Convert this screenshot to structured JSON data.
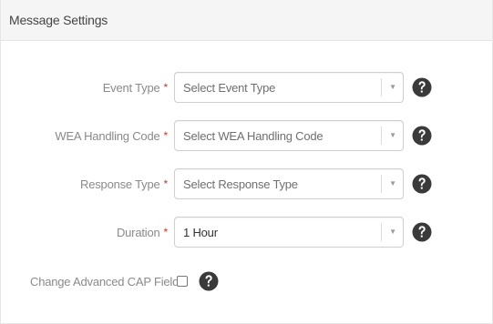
{
  "panel": {
    "title": "Message Settings"
  },
  "form": {
    "required_marker": "*",
    "fields": [
      {
        "label": "Event Type",
        "value": "Select Event Type",
        "is_placeholder": true
      },
      {
        "label": "WEA Handling Code",
        "value": "Select WEA Handling Code",
        "is_placeholder": true
      },
      {
        "label": "Response Type",
        "value": "Select Response Type",
        "is_placeholder": true
      },
      {
        "label": "Duration",
        "value": "1 Hour",
        "is_placeholder": false
      }
    ],
    "advanced_cap": {
      "label": "Change Advanced CAP Fields",
      "checked": false
    }
  },
  "icons": {
    "help": "question-circle-icon",
    "caret": "chevron-down-icon"
  },
  "colors": {
    "required": "#c0392b",
    "label": "#8a8a8a",
    "help_icon": "#3a3a3a",
    "header_bg": "#f5f5f5"
  }
}
